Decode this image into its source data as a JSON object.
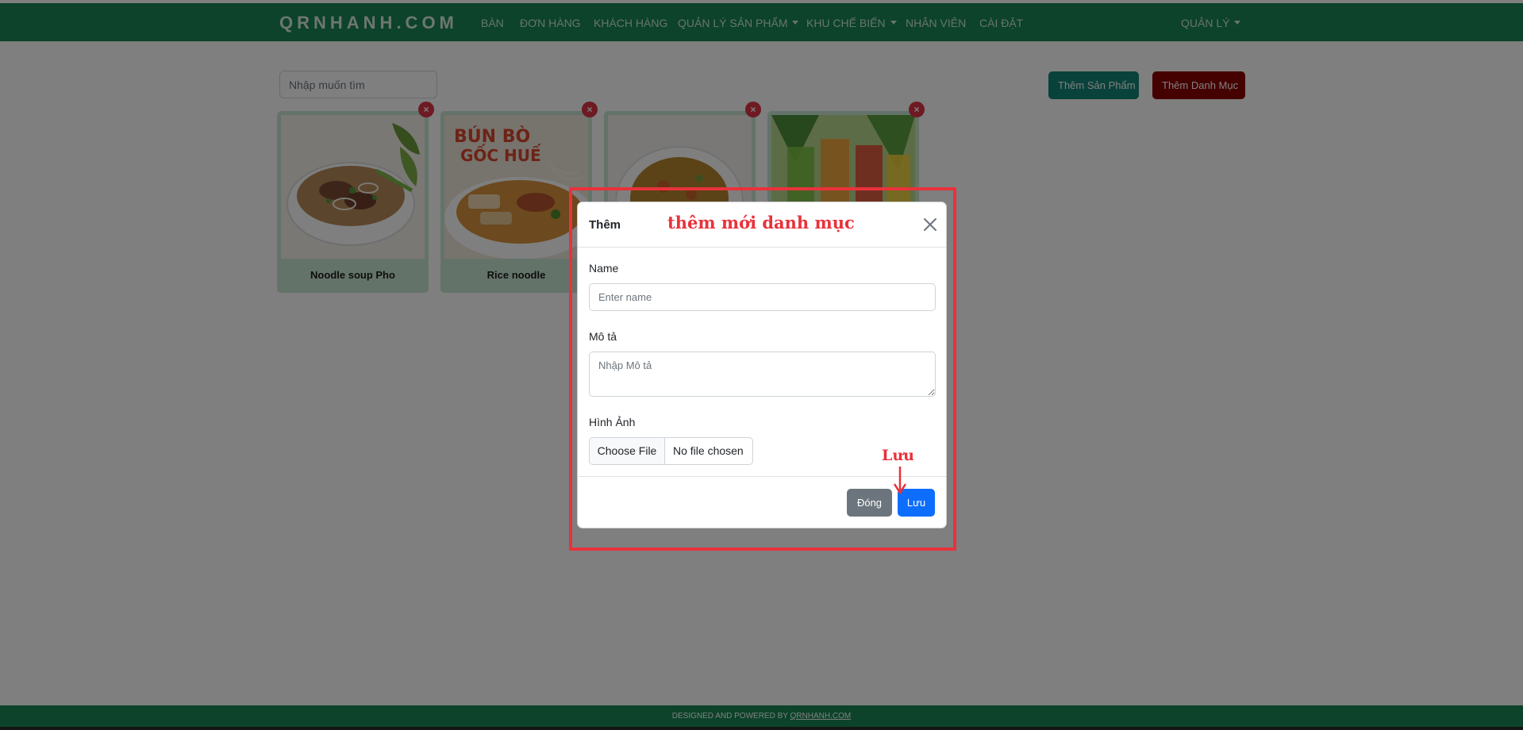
{
  "navbar": {
    "brand": "QRNHANH.COM",
    "items": [
      {
        "label": "BÀN"
      },
      {
        "label": "ĐƠN HÀNG"
      },
      {
        "label": "KHÁCH HÀNG"
      },
      {
        "label": "QUẢN LÝ SẢN PHẨM",
        "dropdown": true
      },
      {
        "label": "KHU CHẾ BIẾN",
        "dropdown": true
      },
      {
        "label": "NHÂN VIÊN"
      },
      {
        "label": "CÀI ĐẶT"
      }
    ],
    "user_menu": "QUẢN LÝ"
  },
  "search": {
    "placeholder": "Nhập muốn tìm"
  },
  "actions": {
    "add_product": "Thêm Sản Phẩm",
    "add_category": "Thêm Danh Mục"
  },
  "categories": [
    {
      "name": "Noodle soup Pho",
      "image": "pho-image"
    },
    {
      "name": "Rice noodle",
      "image": "bun-bo-image",
      "image_text": [
        "BÚN BÒ",
        "GỐC HUẾ"
      ]
    },
    {
      "name": "",
      "image": "fried-rice-image"
    },
    {
      "name": "",
      "image": "juice-image"
    }
  ],
  "delete_icon": "×",
  "modal": {
    "title": "Thêm",
    "name_label": "Name",
    "name_placeholder": "Enter name",
    "desc_label": "Mô tả",
    "desc_placeholder": "Nhập Mô tả",
    "image_label": "Hình Ảnh",
    "file_button": "Choose File",
    "file_status": "No file chosen",
    "close_button": "Đóng",
    "save_button": "Lưu"
  },
  "annotations": {
    "title": "thêm mới danh mục",
    "save": "Lưu"
  },
  "footer": {
    "text": "DESIGNED AND POWERED BY",
    "link": "QRNHANH.COM"
  },
  "colors": {
    "navbar": "#198754",
    "add_product": "#128475",
    "add_category": "#8b0000",
    "primary": "#0d6efd",
    "secondary": "#6c757d",
    "delete": "#dc3545",
    "annotation": "#e8323b"
  }
}
